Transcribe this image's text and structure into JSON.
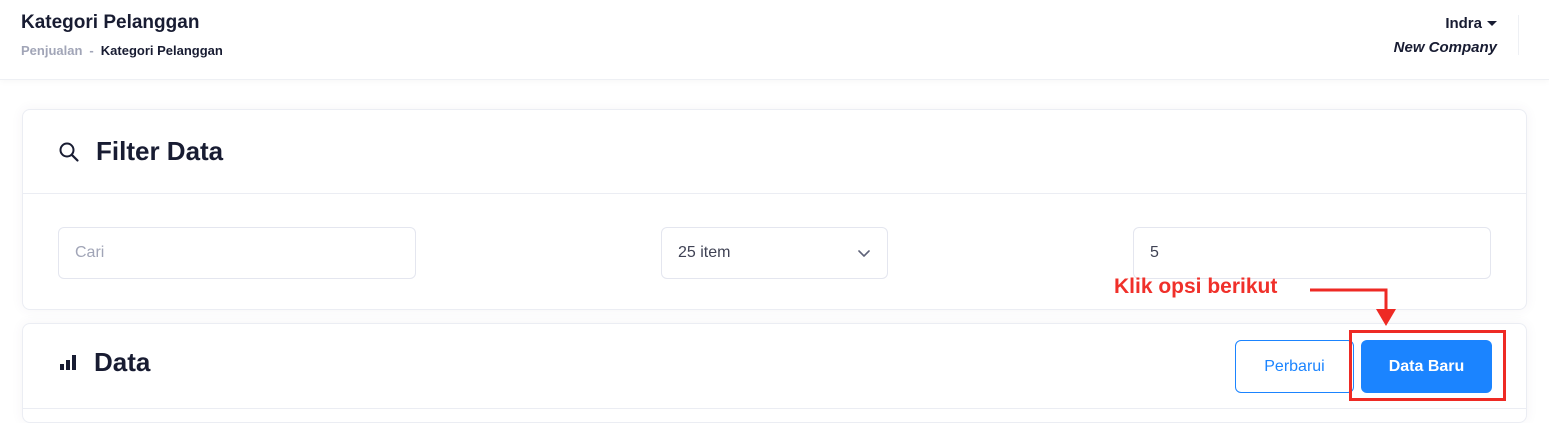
{
  "header": {
    "title": "Kategori Pelanggan",
    "breadcrumb": {
      "parent": "Penjualan",
      "separator": "-",
      "current": "Kategori Pelanggan"
    },
    "user": {
      "name": "Indra",
      "company": "New Company"
    }
  },
  "filter": {
    "title": "Filter Data",
    "icon": "search-icon",
    "search_placeholder": "Cari",
    "per_page_value": "25 item",
    "page_value": "5"
  },
  "data_section": {
    "title": "Data",
    "icon": "bar-chart-icon",
    "refresh_label": "Perbarui",
    "new_label": "Data Baru"
  },
  "annotation": {
    "text": "Klik opsi berikut",
    "color": "#f0302a"
  },
  "colors": {
    "primary": "#1b84ff",
    "title": "#181c32",
    "muted": "#a1a5b7"
  }
}
